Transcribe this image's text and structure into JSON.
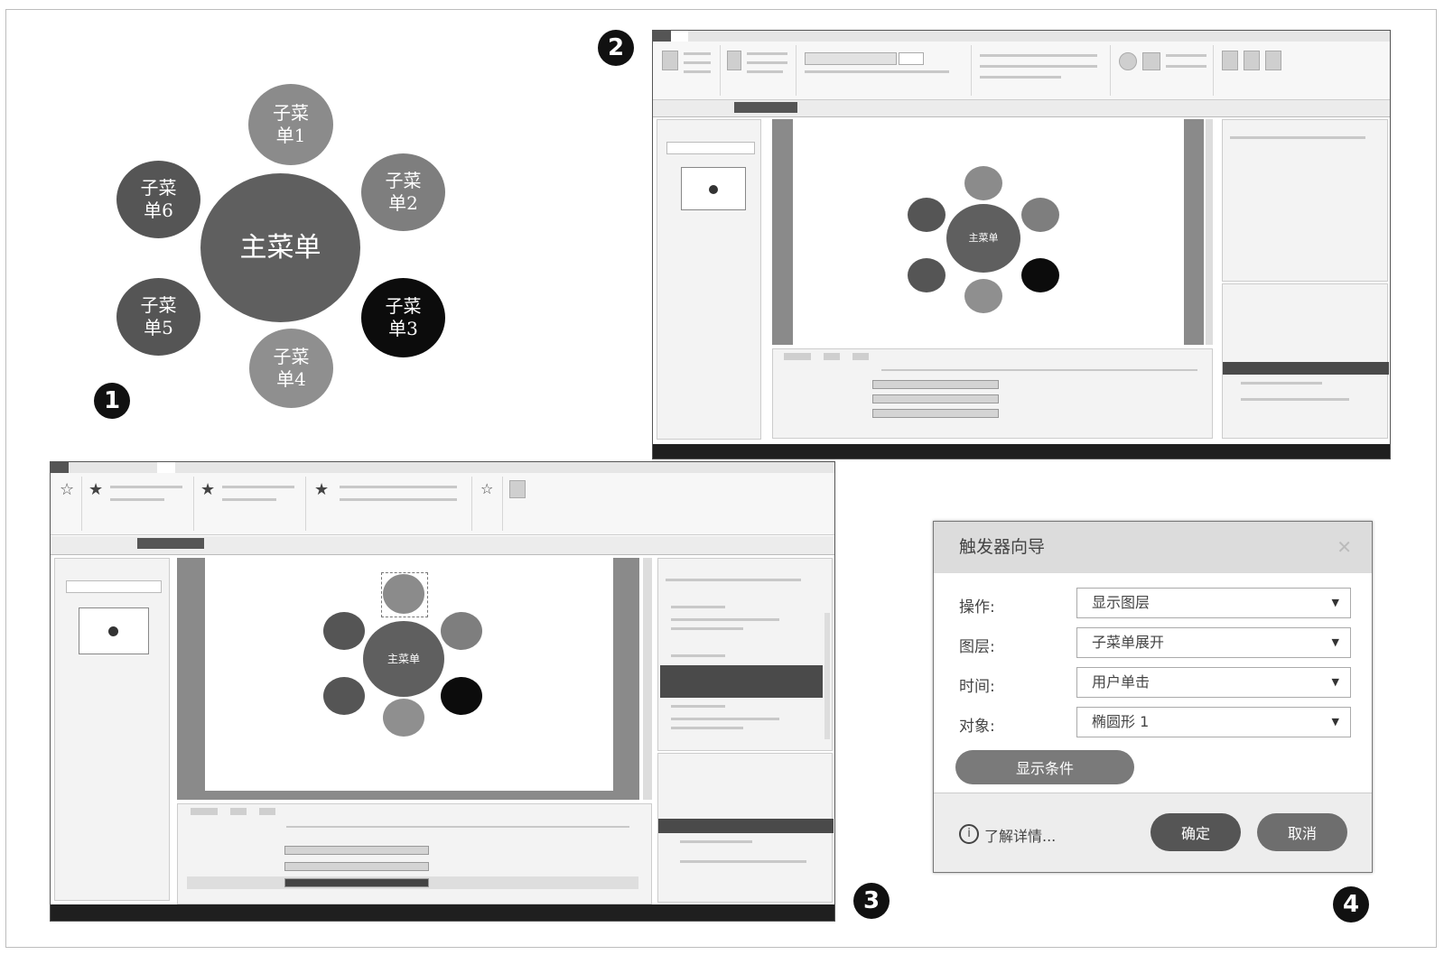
{
  "badges": [
    "1",
    "2",
    "3",
    "4"
  ],
  "figure1": {
    "main_menu": "主菜单",
    "submenus": [
      "子菜单1",
      "子菜单2",
      "子菜单3",
      "子菜单4",
      "子菜单5",
      "子菜单6"
    ],
    "colors": {
      "main": "#5f5f5f",
      "sub1": "#8b8b8b",
      "sub2": "#7e7e7e",
      "sub3": "#0c0c0c",
      "sub4": "#8f8f8f",
      "sub5": "#555555",
      "sub6": "#555555"
    }
  },
  "figure2": {
    "canvas_main_label": "主菜单"
  },
  "figure3": {
    "canvas_main_label": "主菜单"
  },
  "dialog": {
    "title": "触发器向导",
    "close_icon": "close-icon",
    "fields": [
      {
        "label": "操作:",
        "value": "显示图层"
      },
      {
        "label": "图层:",
        "value": "子菜单展开"
      },
      {
        "label": "时间:",
        "value": "用户单击"
      },
      {
        "label": "对象:",
        "value": "椭圆形 1"
      }
    ],
    "conditions_button": "显示条件",
    "info_link": "了解详情...",
    "ok_button": "确定",
    "cancel_button": "取消"
  }
}
